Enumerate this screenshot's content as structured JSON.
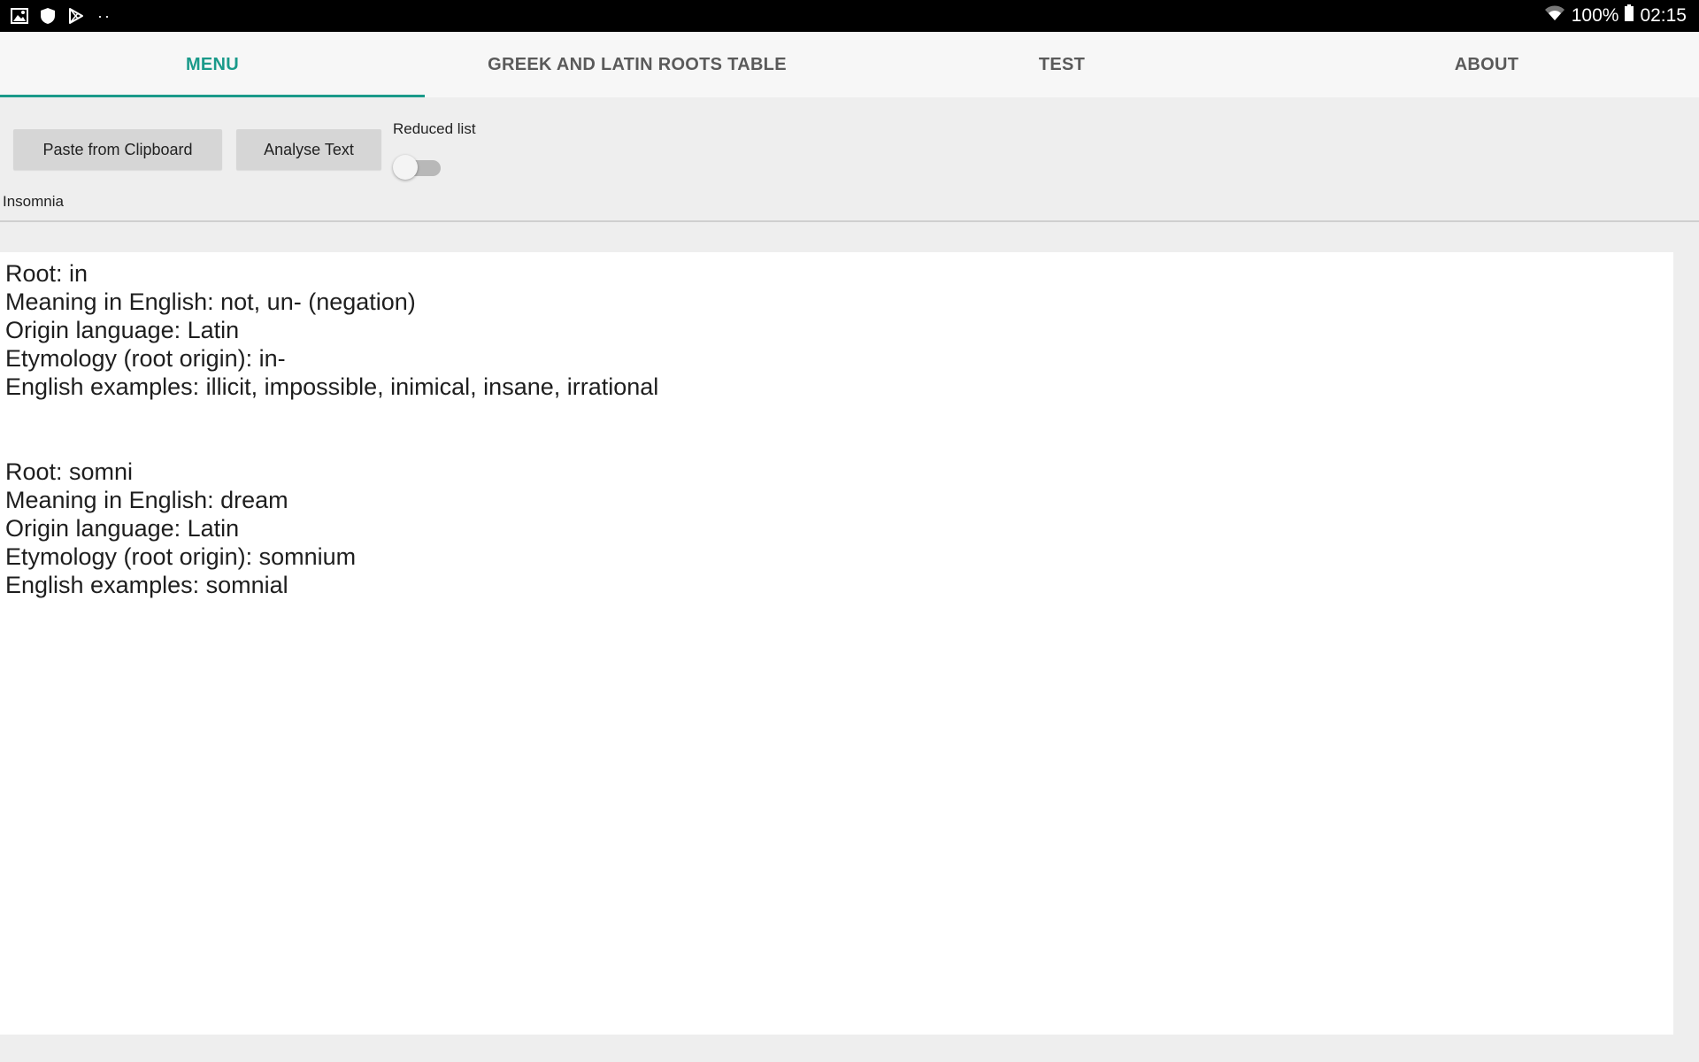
{
  "status_bar": {
    "left_icons": [
      "image-icon",
      "shield-icon",
      "play-store-icon"
    ],
    "overflow": "··",
    "battery_percent": "100%",
    "time": "02:15"
  },
  "tabs": [
    {
      "label": "MENU",
      "active": true
    },
    {
      "label": "GREEK AND LATIN ROOTS TABLE",
      "active": false
    },
    {
      "label": "TEST",
      "active": false
    },
    {
      "label": "ABOUT",
      "active": false
    }
  ],
  "toolbar": {
    "paste_label": "Paste from Clipboard",
    "analyse_label": "Analyse Text",
    "reduced_list_label": "Reduced list",
    "reduced_list_on": false
  },
  "input_word": "Insomnia",
  "results": [
    {
      "root": "Root: in",
      "meaning": "Meaning in English: not, un- (negation)",
      "origin": "Origin language: Latin",
      "etymology": "Etymology (root origin): in-",
      "examples": "English examples: illicit, impossible, inimical, insane, irrational"
    },
    {
      "root": "Root: somni",
      "meaning": "Meaning in English: dream",
      "origin": "Origin language: Latin",
      "etymology": "Etymology (root origin): somnium",
      "examples": "English examples: somnial"
    }
  ],
  "colors": {
    "accent": "#1a9a8a",
    "tab_text": "#5a5a5a",
    "button_bg": "#d6d6d6",
    "background": "#eeeeee"
  }
}
